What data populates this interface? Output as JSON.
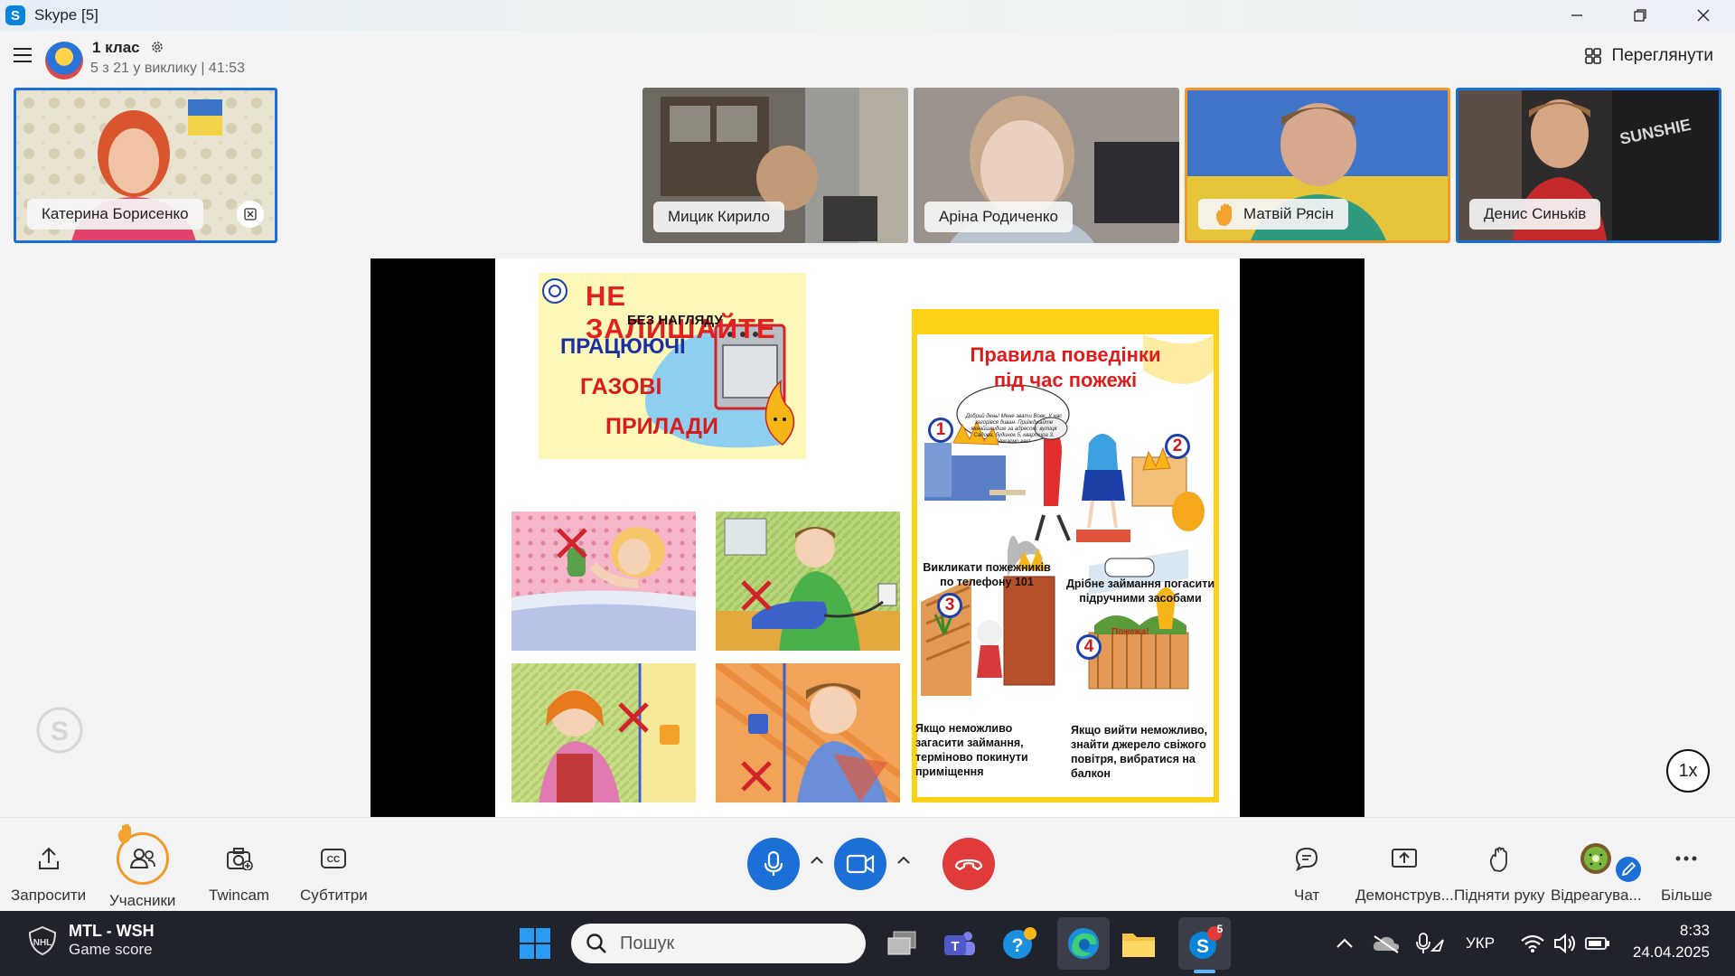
{
  "window": {
    "title": "Skype [5]"
  },
  "call": {
    "name": "1 клас",
    "status": "5 з 21 у виклику | 41:53",
    "view_label": "Переглянути"
  },
  "participants": [
    {
      "name": "Катерина Борисенко"
    },
    {
      "name": "Мицик Кирило"
    },
    {
      "name": "Аріна Родиченко"
    },
    {
      "name": "Матвій Рясін"
    },
    {
      "name": "Денис Синьків"
    }
  ],
  "slide": {
    "flyer": {
      "line1": "НЕ ЗАЛИШАЙТЕ",
      "line2": "БЕЗ НАГЛЯДУ",
      "line3": "ПРАЦЮЮЧІ",
      "line4": "ГАЗОВІ",
      "line5": "ПРИЛАДИ"
    },
    "rules": {
      "title_1": "Правила поведінки",
      "title_2": "під час пожежі",
      "speech": "Добрий день! Мене звати Вовк. У нас загорівся диван. Приїжджайте якнайшвидше за адресою: вулиця Садова, будинок 5, квартира 3. Чекаємо вас!",
      "sign": "Пожежа!",
      "items": [
        {
          "num": "1",
          "caption": "Викликати пожежників по телефону 101"
        },
        {
          "num": "2",
          "caption": "Дрібне займання погасити підручними засобами"
        },
        {
          "num": "3",
          "caption": "Якщо неможливо загасити займання, терміново покинути приміщення"
        },
        {
          "num": "4",
          "caption": "Якщо вийти неможливо, знайти джерело свіжого повітря, вибратися на балкон"
        }
      ]
    }
  },
  "playback_speed": "1x",
  "controls": {
    "invite": "Запросити",
    "participants": "Учасники",
    "twincam": "Twincam",
    "subtitles": "Субтитри",
    "chat": "Чат",
    "share": "Демонструв...",
    "raise_hand": "Підняти руку",
    "react": "Відреагува...",
    "more": "Більше"
  },
  "taskbar": {
    "weather_title": "MTL - WSH",
    "weather_sub": "Game score",
    "search_placeholder": "Пошук",
    "skype_badge": "5",
    "lang": "УКР",
    "time": "8:33",
    "date": "24.04.2025"
  },
  "colors": {
    "accent": "#1b6fd6",
    "hangup": "#e03a3a",
    "raised_hand": "#f19a2b",
    "taskbar": "#20232b"
  }
}
